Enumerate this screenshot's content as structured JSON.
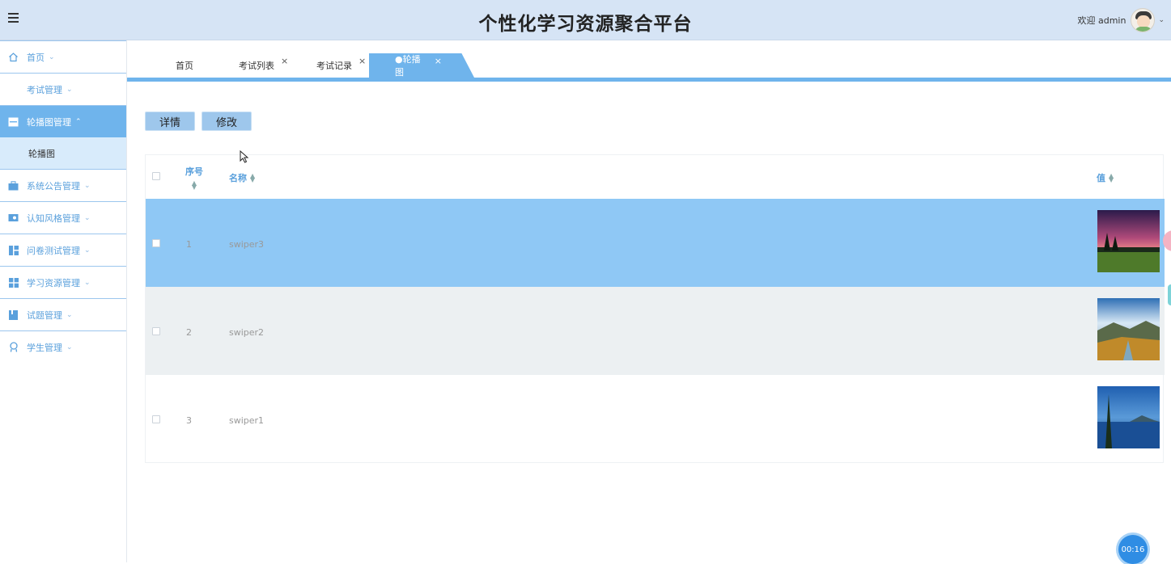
{
  "header": {
    "title": "个性化学习资源聚合平台",
    "welcome": "欢迎 admin"
  },
  "sidebar": {
    "items": [
      {
        "label": "首页",
        "icon": "home-icon"
      },
      {
        "label": "考试管理",
        "icon": ""
      },
      {
        "label": "轮播图管理",
        "icon": "image-icon",
        "active": true
      },
      {
        "label": "系统公告管理",
        "icon": "briefcase-icon"
      },
      {
        "label": "认知风格管理",
        "icon": "id-card-icon"
      },
      {
        "label": "问卷测试管理",
        "icon": "dashboard-icon"
      },
      {
        "label": "学习资源管理",
        "icon": "grid-icon"
      },
      {
        "label": "试题管理",
        "icon": "book-icon"
      },
      {
        "label": "学生管理",
        "icon": "user-icon"
      }
    ],
    "sub_item": "轮播图"
  },
  "tabs": [
    {
      "label": "首页",
      "closable": false
    },
    {
      "label": "考试列表",
      "closable": true
    },
    {
      "label": "考试记录",
      "closable": true
    },
    {
      "label": "●轮播图",
      "closable": true,
      "active": true
    }
  ],
  "toolbar": {
    "detail_label": "详情",
    "edit_label": "修改"
  },
  "table": {
    "columns": {
      "index": "序号",
      "name": "名称",
      "value": "值"
    },
    "rows": [
      {
        "index": "1",
        "name": "swiper3",
        "selected": true
      },
      {
        "index": "2",
        "name": "swiper2",
        "selected": false
      },
      {
        "index": "3",
        "name": "swiper1",
        "selected": false
      }
    ]
  },
  "timer": "00:16",
  "close_glyph": "×",
  "colors": {
    "accent": "#6fb4ec",
    "header_bg": "#d6e4f5",
    "selected_row": "#8fc8f5",
    "alt_row": "#ecf0f2"
  }
}
